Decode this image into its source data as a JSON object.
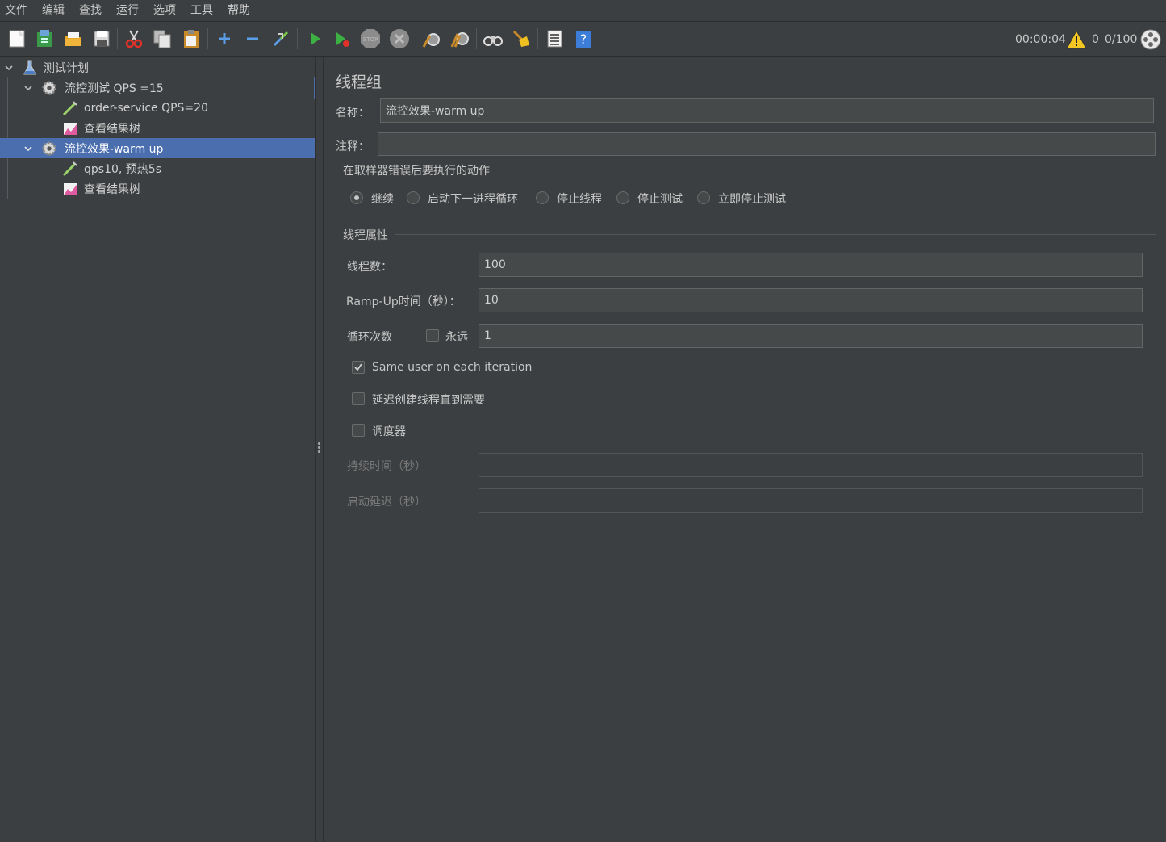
{
  "menu": [
    "文件",
    "编辑",
    "查找",
    "运行",
    "选项",
    "工具",
    "帮助"
  ],
  "toolbar": {
    "buttons": [
      "new-icon",
      "templates-icon",
      "open-icon",
      "save-icon",
      "cut-icon",
      "copy-icon",
      "paste-icon",
      "expand-icon",
      "collapse-icon",
      "toggle-icon",
      "start-icon",
      "start-no-pause-icon",
      "stop-icon",
      "shutdown-icon",
      "clear-icon",
      "clear-all-icon",
      "search-icon",
      "reset-search-icon",
      "function-helper-icon",
      "help-icon"
    ],
    "elapsed": "00:00:04",
    "warnings": "0",
    "threads": "0/100"
  },
  "tree": {
    "items": [
      {
        "label": "测试计划",
        "icon": "test-plan-icon"
      },
      {
        "label": "流控测试 QPS =15",
        "icon": "thread-group-icon"
      },
      {
        "label": "order-service QPS=20",
        "icon": "sampler-icon"
      },
      {
        "label": "查看结果树",
        "icon": "listener-icon"
      },
      {
        "label": "流控效果-warm up",
        "icon": "thread-group-icon"
      },
      {
        "label": "qps10, 预热5s",
        "icon": "sampler-icon"
      },
      {
        "label": "查看结果树",
        "icon": "listener-icon"
      }
    ]
  },
  "form": {
    "title": "线程组",
    "name_label": "名称：",
    "name_value": "流控效果-warm up",
    "comment_label": "注释：",
    "comment_value": "",
    "error_action_title": "在取样器错误后要执行的动作",
    "error_actions": [
      "继续",
      "启动下一进程循环",
      "停止线程",
      "停止测试",
      "立即停止测试"
    ],
    "selected_action": "继续",
    "thread_props_title": "线程属性",
    "threads_label": "线程数：",
    "threads_value": "100",
    "rampup_label": "Ramp-Up时间（秒）：",
    "rampup_value": "10",
    "loop_label": "循环次数",
    "forever_label": "永远",
    "forever_checked": false,
    "loop_value": "1",
    "same_user_label": "Same user on each iteration",
    "same_user_checked": true,
    "delay_create_label": "延迟创建线程直到需要",
    "delay_create_checked": false,
    "scheduler_label": "调度器",
    "scheduler_checked": false,
    "duration_label": "持续时间（秒）",
    "duration_value": "",
    "startup_delay_label": "启动延迟（秒）",
    "startup_delay_value": ""
  }
}
